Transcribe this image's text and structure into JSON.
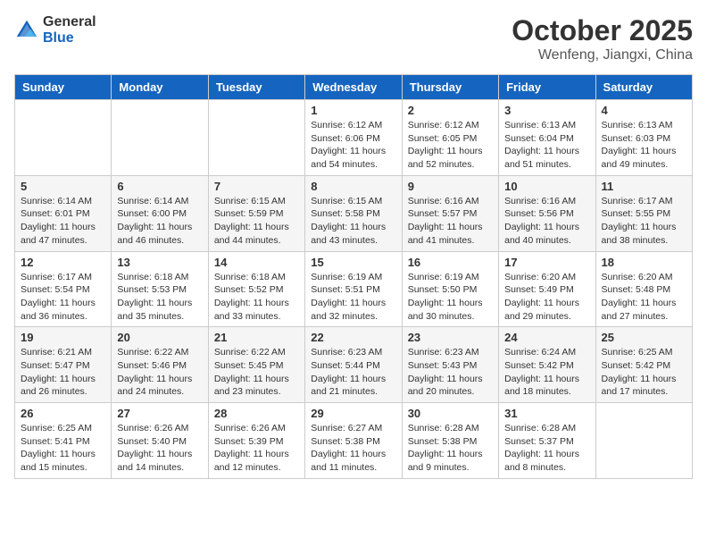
{
  "header": {
    "logo_general": "General",
    "logo_blue": "Blue",
    "month_title": "October 2025",
    "location": "Wenfeng, Jiangxi, China"
  },
  "weekdays": [
    "Sunday",
    "Monday",
    "Tuesday",
    "Wednesday",
    "Thursday",
    "Friday",
    "Saturday"
  ],
  "weeks": [
    [
      {
        "day": "",
        "info": ""
      },
      {
        "day": "",
        "info": ""
      },
      {
        "day": "",
        "info": ""
      },
      {
        "day": "1",
        "info": "Sunrise: 6:12 AM\nSunset: 6:06 PM\nDaylight: 11 hours\nand 54 minutes."
      },
      {
        "day": "2",
        "info": "Sunrise: 6:12 AM\nSunset: 6:05 PM\nDaylight: 11 hours\nand 52 minutes."
      },
      {
        "day": "3",
        "info": "Sunrise: 6:13 AM\nSunset: 6:04 PM\nDaylight: 11 hours\nand 51 minutes."
      },
      {
        "day": "4",
        "info": "Sunrise: 6:13 AM\nSunset: 6:03 PM\nDaylight: 11 hours\nand 49 minutes."
      }
    ],
    [
      {
        "day": "5",
        "info": "Sunrise: 6:14 AM\nSunset: 6:01 PM\nDaylight: 11 hours\nand 47 minutes."
      },
      {
        "day": "6",
        "info": "Sunrise: 6:14 AM\nSunset: 6:00 PM\nDaylight: 11 hours\nand 46 minutes."
      },
      {
        "day": "7",
        "info": "Sunrise: 6:15 AM\nSunset: 5:59 PM\nDaylight: 11 hours\nand 44 minutes."
      },
      {
        "day": "8",
        "info": "Sunrise: 6:15 AM\nSunset: 5:58 PM\nDaylight: 11 hours\nand 43 minutes."
      },
      {
        "day": "9",
        "info": "Sunrise: 6:16 AM\nSunset: 5:57 PM\nDaylight: 11 hours\nand 41 minutes."
      },
      {
        "day": "10",
        "info": "Sunrise: 6:16 AM\nSunset: 5:56 PM\nDaylight: 11 hours\nand 40 minutes."
      },
      {
        "day": "11",
        "info": "Sunrise: 6:17 AM\nSunset: 5:55 PM\nDaylight: 11 hours\nand 38 minutes."
      }
    ],
    [
      {
        "day": "12",
        "info": "Sunrise: 6:17 AM\nSunset: 5:54 PM\nDaylight: 11 hours\nand 36 minutes."
      },
      {
        "day": "13",
        "info": "Sunrise: 6:18 AM\nSunset: 5:53 PM\nDaylight: 11 hours\nand 35 minutes."
      },
      {
        "day": "14",
        "info": "Sunrise: 6:18 AM\nSunset: 5:52 PM\nDaylight: 11 hours\nand 33 minutes."
      },
      {
        "day": "15",
        "info": "Sunrise: 6:19 AM\nSunset: 5:51 PM\nDaylight: 11 hours\nand 32 minutes."
      },
      {
        "day": "16",
        "info": "Sunrise: 6:19 AM\nSunset: 5:50 PM\nDaylight: 11 hours\nand 30 minutes."
      },
      {
        "day": "17",
        "info": "Sunrise: 6:20 AM\nSunset: 5:49 PM\nDaylight: 11 hours\nand 29 minutes."
      },
      {
        "day": "18",
        "info": "Sunrise: 6:20 AM\nSunset: 5:48 PM\nDaylight: 11 hours\nand 27 minutes."
      }
    ],
    [
      {
        "day": "19",
        "info": "Sunrise: 6:21 AM\nSunset: 5:47 PM\nDaylight: 11 hours\nand 26 minutes."
      },
      {
        "day": "20",
        "info": "Sunrise: 6:22 AM\nSunset: 5:46 PM\nDaylight: 11 hours\nand 24 minutes."
      },
      {
        "day": "21",
        "info": "Sunrise: 6:22 AM\nSunset: 5:45 PM\nDaylight: 11 hours\nand 23 minutes."
      },
      {
        "day": "22",
        "info": "Sunrise: 6:23 AM\nSunset: 5:44 PM\nDaylight: 11 hours\nand 21 minutes."
      },
      {
        "day": "23",
        "info": "Sunrise: 6:23 AM\nSunset: 5:43 PM\nDaylight: 11 hours\nand 20 minutes."
      },
      {
        "day": "24",
        "info": "Sunrise: 6:24 AM\nSunset: 5:42 PM\nDaylight: 11 hours\nand 18 minutes."
      },
      {
        "day": "25",
        "info": "Sunrise: 6:25 AM\nSunset: 5:42 PM\nDaylight: 11 hours\nand 17 minutes."
      }
    ],
    [
      {
        "day": "26",
        "info": "Sunrise: 6:25 AM\nSunset: 5:41 PM\nDaylight: 11 hours\nand 15 minutes."
      },
      {
        "day": "27",
        "info": "Sunrise: 6:26 AM\nSunset: 5:40 PM\nDaylight: 11 hours\nand 14 minutes."
      },
      {
        "day": "28",
        "info": "Sunrise: 6:26 AM\nSunset: 5:39 PM\nDaylight: 11 hours\nand 12 minutes."
      },
      {
        "day": "29",
        "info": "Sunrise: 6:27 AM\nSunset: 5:38 PM\nDaylight: 11 hours\nand 11 minutes."
      },
      {
        "day": "30",
        "info": "Sunrise: 6:28 AM\nSunset: 5:38 PM\nDaylight: 11 hours\nand 9 minutes."
      },
      {
        "day": "31",
        "info": "Sunrise: 6:28 AM\nSunset: 5:37 PM\nDaylight: 11 hours\nand 8 minutes."
      },
      {
        "day": "",
        "info": ""
      }
    ]
  ]
}
